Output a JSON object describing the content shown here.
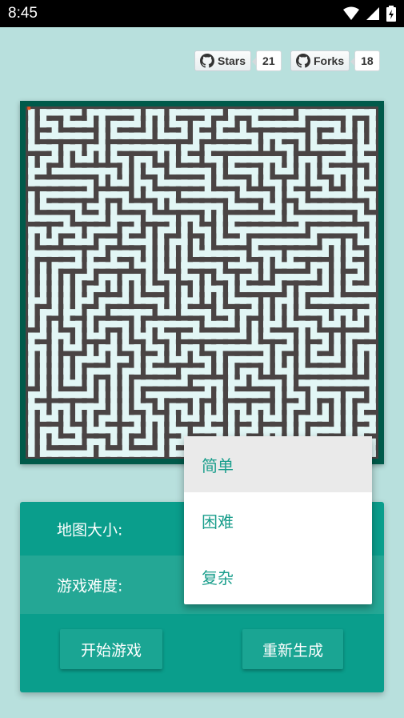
{
  "status": {
    "time": "8:45"
  },
  "github": {
    "stars_label": "Stars",
    "stars_count": "21",
    "forks_label": "Forks",
    "forks_count": "18"
  },
  "panel": {
    "map_size_label": "地图大小:",
    "difficulty_label": "游戏难度:",
    "start_button": "开始游戏",
    "regenerate_button": "重新生成"
  },
  "dropdown": {
    "options": [
      "简单",
      "困难",
      "复杂"
    ],
    "selected_index": 0
  },
  "colors": {
    "maze_wall": "#4a4444",
    "maze_path": "#e2f6f5",
    "maze_border": "#005a4a",
    "player": "#e0521f",
    "accent": "#0a9e8c"
  }
}
